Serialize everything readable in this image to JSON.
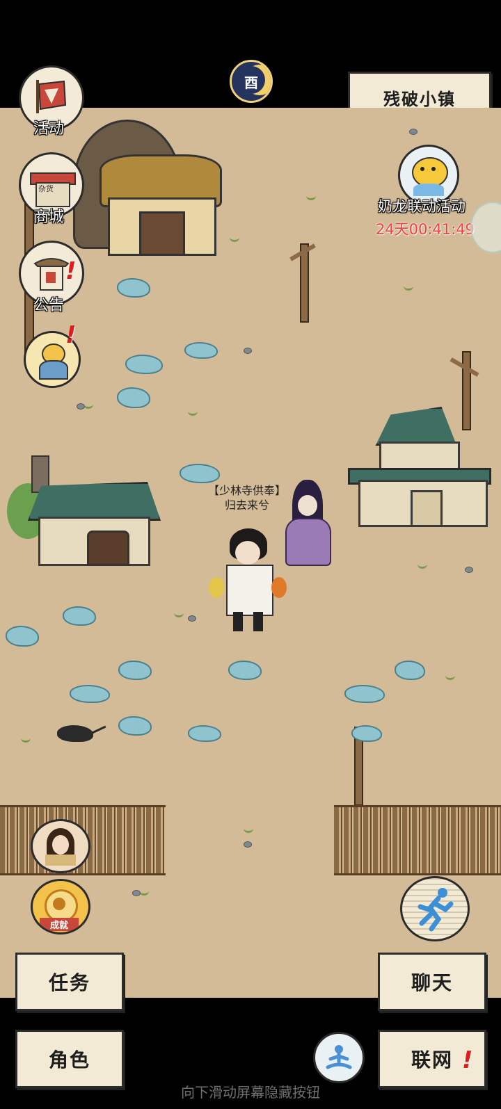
{
  "location": {
    "name": "残破小镇"
  },
  "time_badge": {
    "glyph": "酉",
    "icon": "moon-time-icon"
  },
  "left_menu": [
    {
      "id": "activity",
      "label": "活动",
      "icon": "scroll-banner-icon"
    },
    {
      "id": "shop",
      "label": "商城",
      "icon": "shop-stall-icon",
      "sign": "杂货"
    },
    {
      "id": "notice",
      "label": "公告",
      "icon": "notice-gate-icon"
    },
    {
      "id": "character-event",
      "label": "",
      "icon": "character-portrait-icon"
    }
  ],
  "event": {
    "title": "奶龙联动活动",
    "countdown": "24天00:41:49",
    "icon": "yellow-mascot-icon"
  },
  "player": {
    "title": "【少林寺供奉】",
    "name": "归去来兮"
  },
  "bottom_left_icons": [
    {
      "id": "companion",
      "icon": "companion-portrait-icon"
    },
    {
      "id": "achievement",
      "label": "成就",
      "icon": "achievement-medal-icon"
    }
  ],
  "run_button": {
    "icon": "running-man-icon"
  },
  "buttons": {
    "tasks": "任务",
    "chat": "聊天",
    "role": "角色",
    "network": "联网"
  },
  "meditate": {
    "icon": "meditation-icon"
  },
  "hint": "向下滑动屏幕隐藏按钮",
  "colors": {
    "ground": "#d3bb97",
    "roof_green": "#3f6f63",
    "water_stone": "#8fc4cf",
    "alert_red": "#e21a1a",
    "button_bg": "#f2ead5"
  }
}
